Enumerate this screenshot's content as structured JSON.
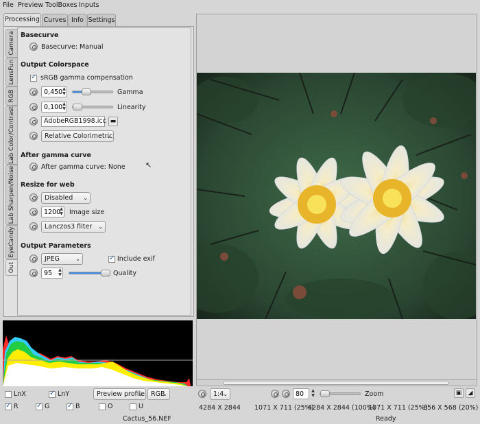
{
  "menu": [
    "File",
    "Preview",
    "ToolBoxes",
    "Inputs"
  ],
  "tabs": [
    "Processing",
    "Curves",
    "Info",
    "Settings"
  ],
  "vtabs": [
    "Camera",
    "LensFun",
    "RGB",
    "Lab Color/Contrast",
    "Lab Sharpen/Noise",
    "EyeCandy",
    "Out"
  ],
  "basecurve": {
    "title": "Basecurve",
    "label": "Basecurve: Manual"
  },
  "output_colorspace": {
    "title": "Output Colorspace",
    "srgb_label": "sRGB gamma compensation",
    "gamma_value": "0,450",
    "gamma_label": "Gamma",
    "gamma_level": 0.35,
    "linearity_value": "0,100",
    "linearity_label": "Linearity",
    "linearity_level": 0.12,
    "profile_file": "AdobeRGB1998.icc",
    "intent": "Relative Colorimetric"
  },
  "after_gamma": {
    "title": "After gamma curve",
    "label": "After gamma curve: None"
  },
  "resize": {
    "title": "Resize for web",
    "mode": "Disabled",
    "size_value": "1200",
    "size_label": "Image size",
    "filter": "Lanczos3 filter"
  },
  "output_params": {
    "title": "Output Parameters",
    "format": "JPEG",
    "exif_label": "Include exif",
    "quality_value": "95",
    "quality_label": "Quality",
    "quality_level": 0.95
  },
  "histogram_controls": {
    "lnx": "LnX",
    "lny": "LnY",
    "profile": "Preview profile",
    "space": "RGB",
    "r": "R",
    "g": "G",
    "b": "B",
    "o": "O",
    "u": "U"
  },
  "viewer": {
    "zoom_select": "1:4",
    "zoom_value": "80",
    "zoom_label": "Zoom",
    "zoom_level": 0.1
  },
  "sizes": [
    "4284 X 2844",
    "1071 X 711 (25%)",
    "4284 X 2844 (100%)",
    "1071 X 711 (25%)",
    "856 X 568 (20%)"
  ],
  "status": {
    "file": "Cactus_56.NEF",
    "state": "Ready"
  },
  "colors": {
    "accent": "#3d8ee6",
    "histogram_bg": "#000000"
  }
}
